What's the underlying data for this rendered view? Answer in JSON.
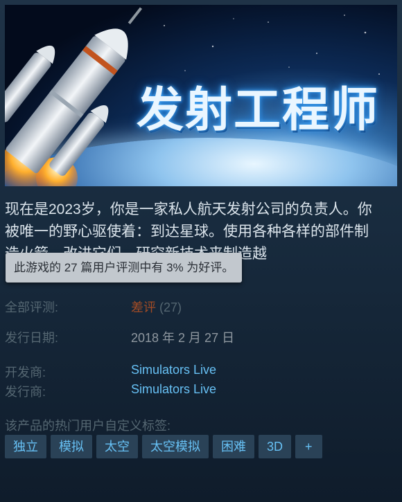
{
  "header": {
    "title": "发射工程师"
  },
  "description": "现在是2023岁，你是一家私人航天发射公司的负责人。你被唯一的野心驱使着：到达星球。使用各种各样的部件制造火箭，改进它们，研究新技术来制造越",
  "tooltip": "此游戏的 27 篇用户评测中有 3% 为好评。",
  "reviews": {
    "label": "全部评测:",
    "summary": "差评",
    "count": "(27)",
    "summary_color": "#a34c25",
    "positive_percent": 3
  },
  "release": {
    "label": "发行日期:",
    "date": "2018 年 2 月 27 日"
  },
  "developer": {
    "label": "开发商:",
    "name": "Simulators Live"
  },
  "publisher": {
    "label": "发行商:",
    "name": "Simulators Live"
  },
  "tags": {
    "label": "该产品的热门用户自定义标签:",
    "items": [
      "独立",
      "模拟",
      "太空",
      "太空模拟",
      "困难",
      "3D"
    ],
    "more": "+"
  },
  "colors": {
    "accent": "#67c1f5",
    "tag_bg": "#2a4257",
    "label": "#556772",
    "tooltip_bg": "#c2c8ce"
  },
  "icons": {
    "capsule_art": "rocket-launch-art"
  }
}
